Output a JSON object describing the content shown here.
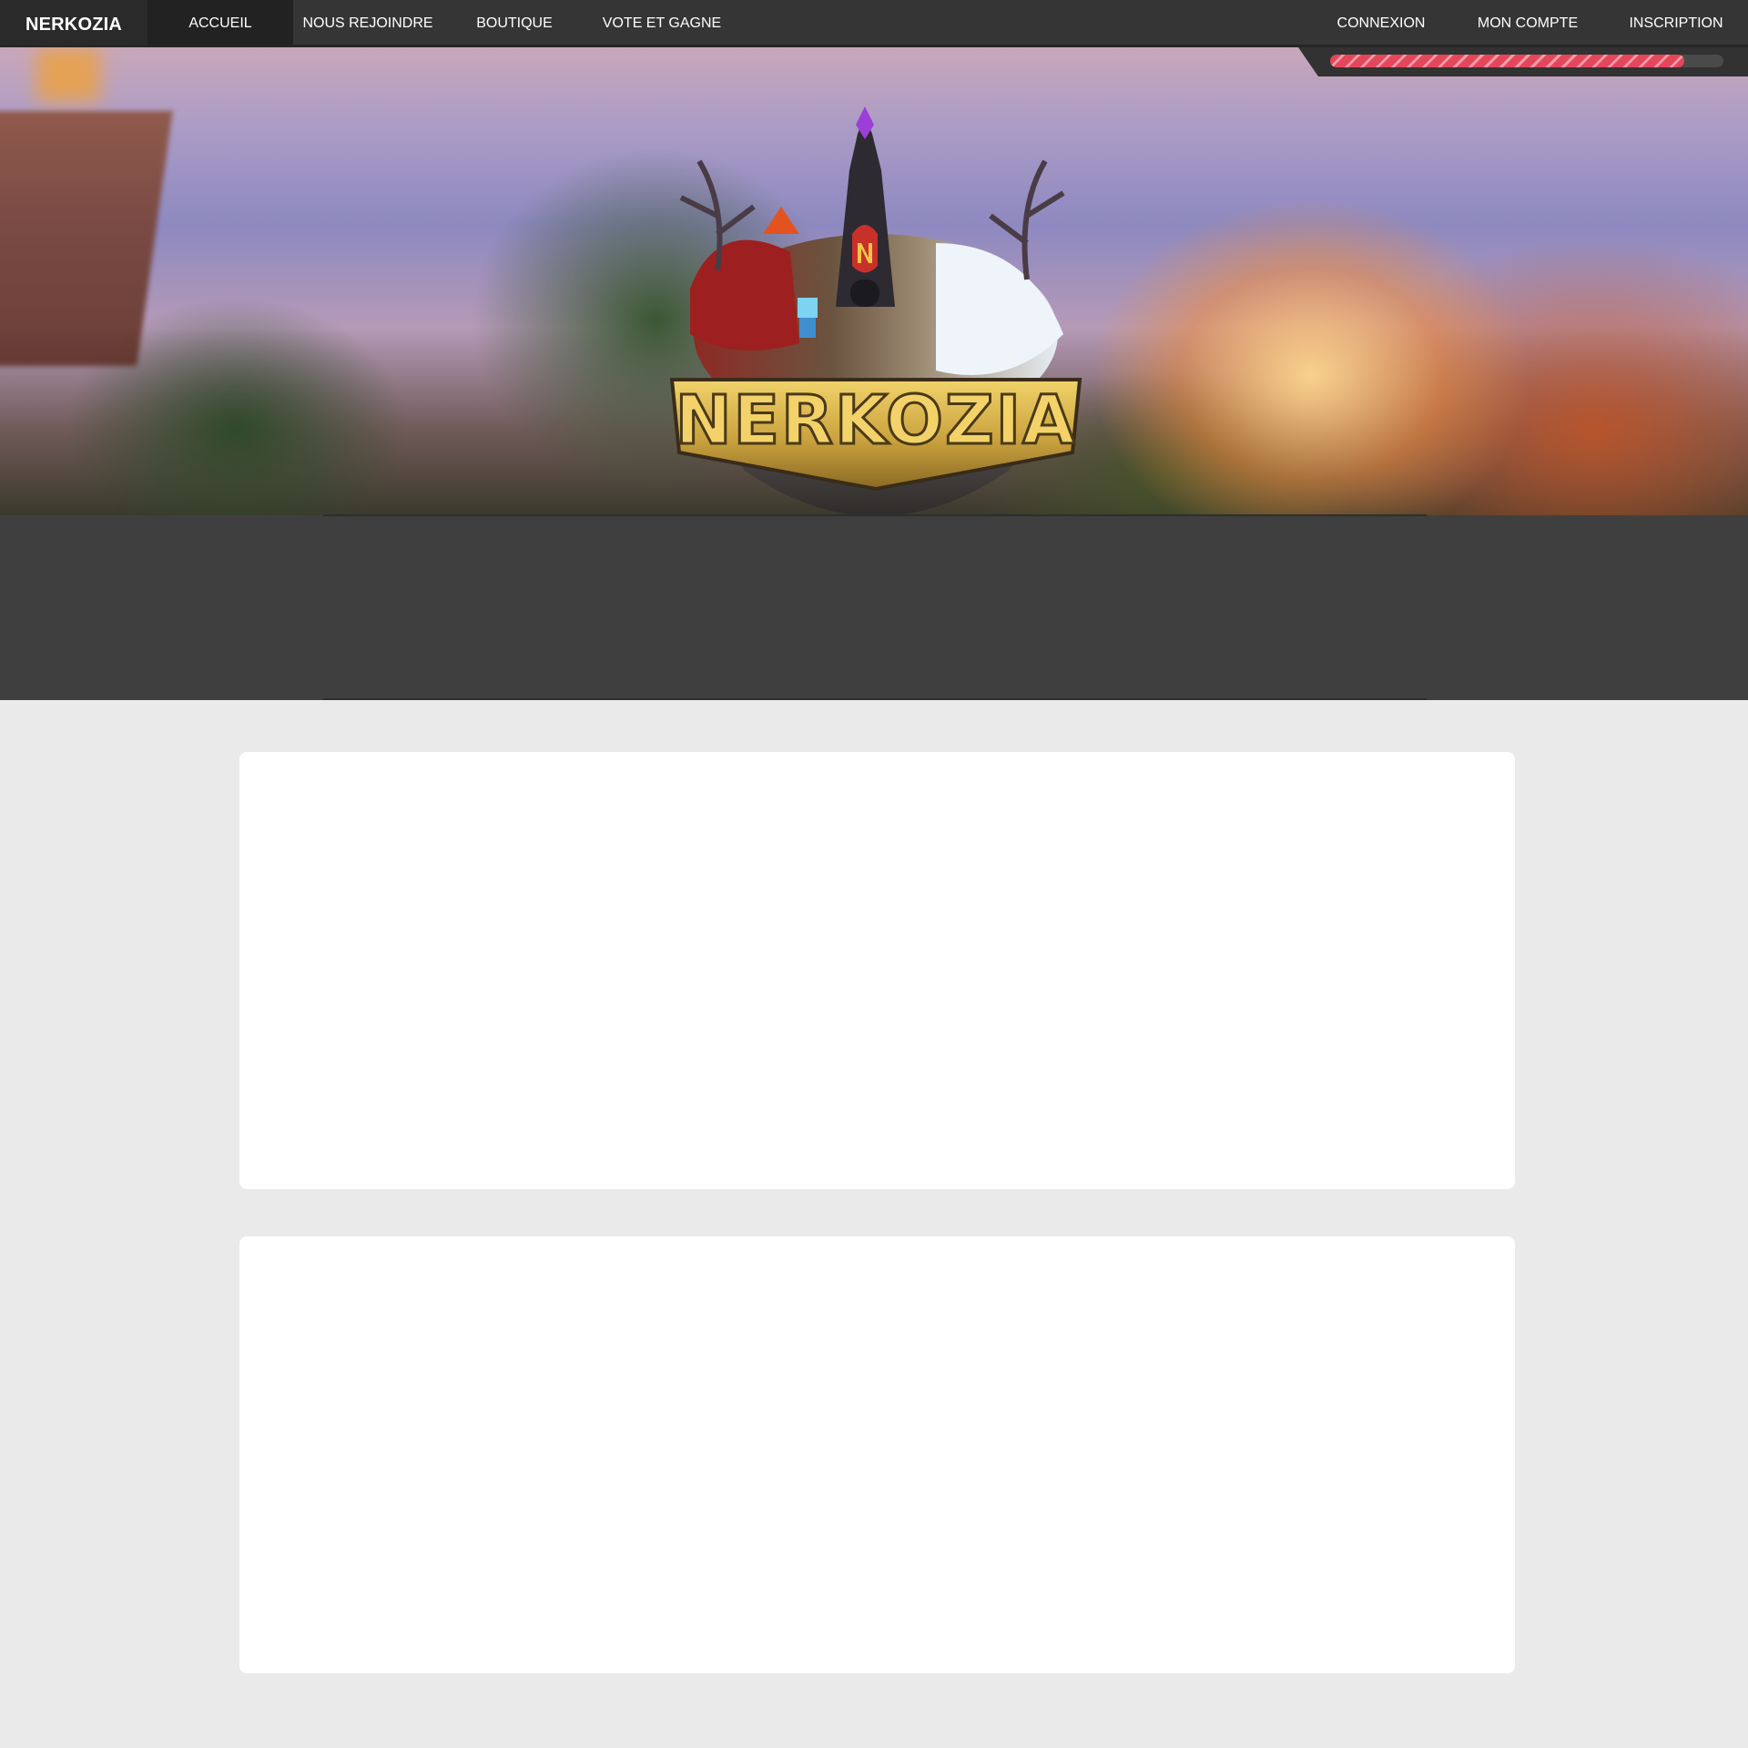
{
  "nav": {
    "brand": "NERKOZIA",
    "left_items": [
      {
        "label": "ACCUEIL",
        "active": true
      },
      {
        "label": "NOUS REJOINDRE",
        "active": false
      },
      {
        "label": "BOUTIQUE",
        "active": false
      },
      {
        "label": "VOTE ET GAGNE",
        "active": false
      }
    ],
    "right_items": [
      {
        "label": "CONNEXION"
      },
      {
        "label": "MON COMPTE"
      },
      {
        "label": "INSCRIPTION"
      }
    ]
  },
  "progress": {
    "value": 0.9,
    "fill_color": "#e4465a"
  },
  "hero": {
    "logo_text": "NERKOZIA",
    "logo_emblem": "N"
  },
  "colors": {
    "navbar": "#353535",
    "active_tab": "#222222",
    "band": "#3f3f3f",
    "page_bg": "#eaeaea",
    "card": "#ffffff"
  }
}
